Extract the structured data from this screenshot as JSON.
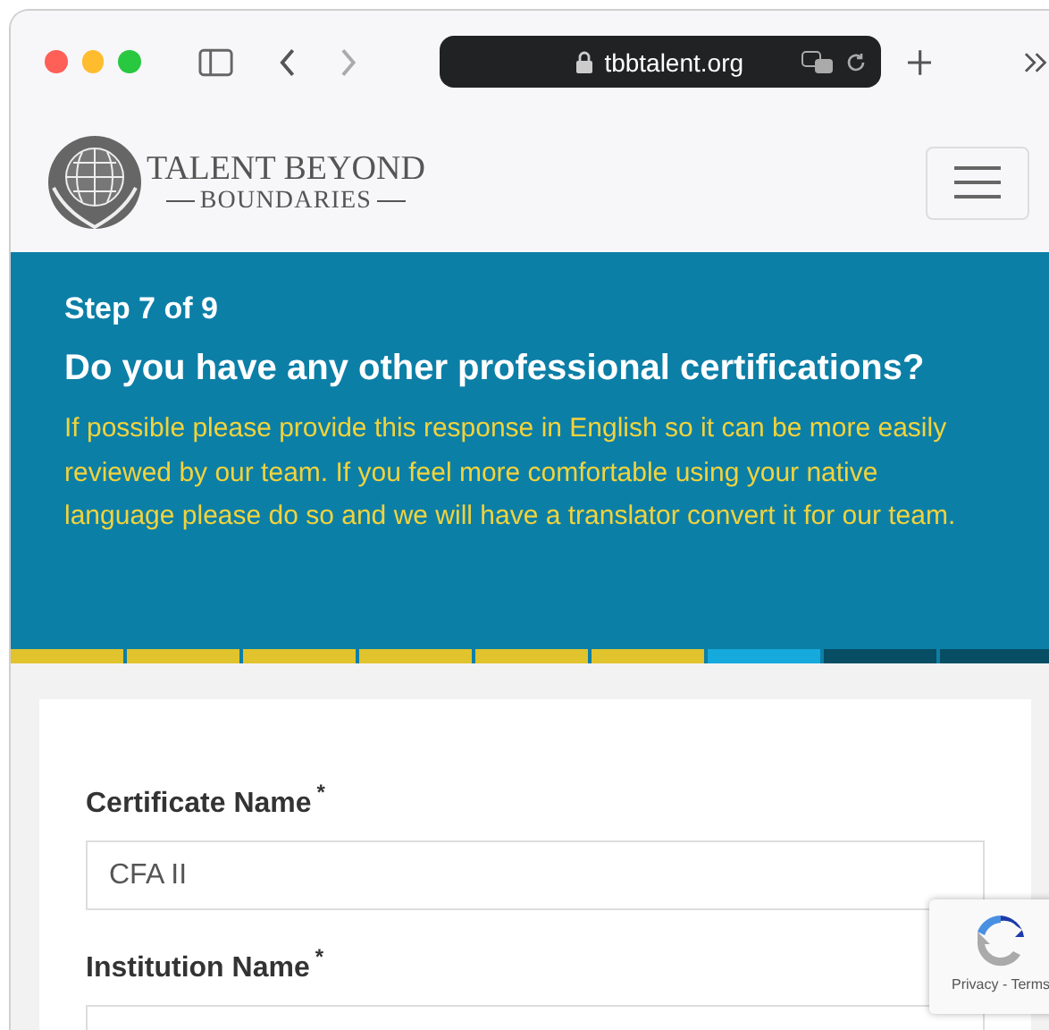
{
  "browser": {
    "address": "tbbtalent.org"
  },
  "site": {
    "logo_line_1": "TALENT BEYOND",
    "logo_line_2": "BOUNDARIES"
  },
  "banner": {
    "step": "Step 7 of 9",
    "question": "Do you have any other professional certifications?",
    "hint": "If possible please provide this response in English so it can be more easily reviewed by our team. If you feel more comfortable using your native language please do so and we will have a translator convert it for our team."
  },
  "progress": [
    {
      "complete": true
    },
    {
      "complete": true
    },
    {
      "complete": true
    },
    {
      "complete": true
    },
    {
      "complete": true
    },
    {
      "complete": true
    },
    {
      "complete": false
    },
    {
      "complete": false
    },
    {
      "complete": false
    }
  ],
  "form": {
    "fields": [
      {
        "label": "Certificate Name",
        "required_mark": "*",
        "value": "CFA II"
      },
      {
        "label": "Institution Name",
        "required_mark": "*"
      }
    ]
  },
  "recaptcha": {
    "links": "Privacy - Terms"
  }
}
